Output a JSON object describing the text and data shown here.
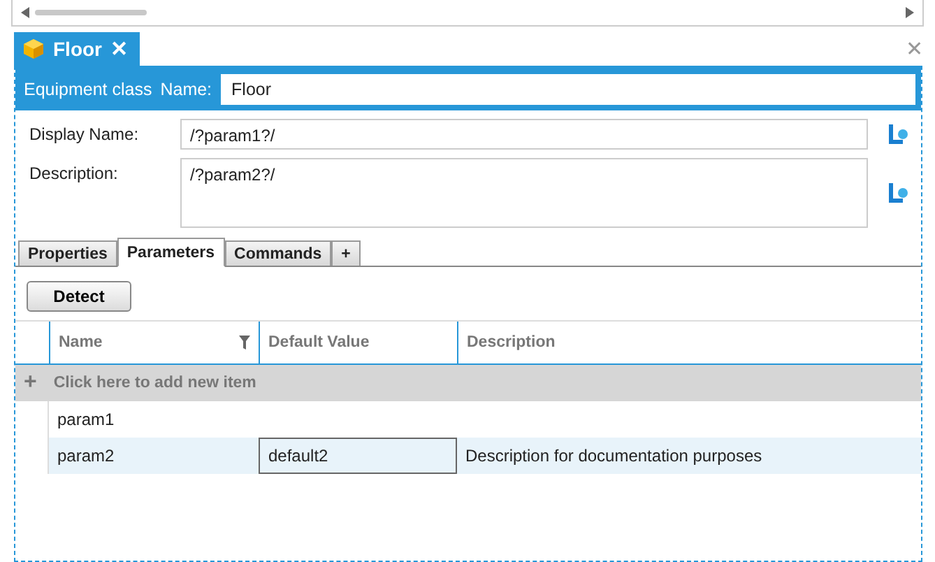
{
  "document_tab": {
    "title": "Floor",
    "close": "✕"
  },
  "close_panel": "✕",
  "header": {
    "class_label": "Equipment class",
    "name_label": "Name:",
    "name_value": "Floor"
  },
  "fields": [
    {
      "label": "Display Name:",
      "value": "/?param1?/",
      "multiline": false
    },
    {
      "label": "Description:",
      "value": "/?param2?/",
      "multiline": true
    }
  ],
  "tabs": [
    {
      "label": "Properties",
      "selected": false
    },
    {
      "label": "Parameters",
      "selected": true
    },
    {
      "label": "Commands",
      "selected": false
    },
    {
      "label": "+",
      "selected": false
    }
  ],
  "detect_button": "Detect",
  "table": {
    "columns": [
      {
        "label": "Name",
        "filter": true
      },
      {
        "label": "Default Value",
        "filter": false
      },
      {
        "label": "Description",
        "filter": false
      }
    ],
    "add_row": {
      "icon": "+",
      "label": "Click here to add new item"
    },
    "rows": [
      {
        "cells": [
          "param1",
          "",
          ""
        ],
        "selected": false
      },
      {
        "cells": [
          "param2",
          "default2",
          "Description for documentation purposes"
        ],
        "selected": true
      }
    ]
  }
}
